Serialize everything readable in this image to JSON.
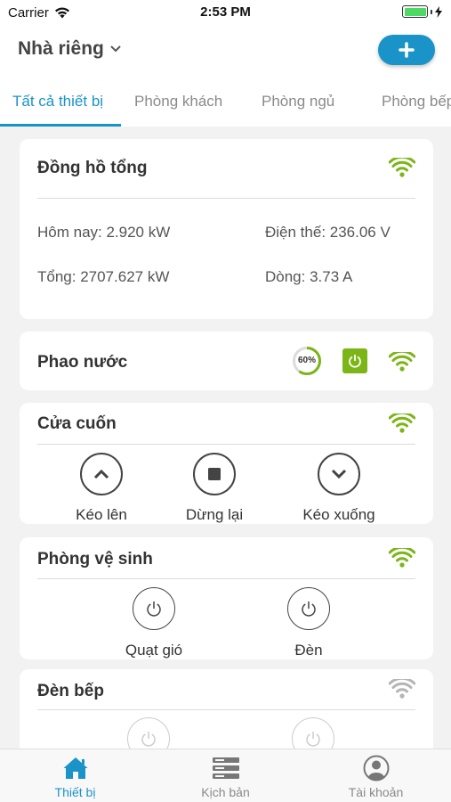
{
  "status_bar": {
    "carrier": "Carrier",
    "time": "2:53 PM"
  },
  "header": {
    "home_name": "Nhà riêng",
    "add_label": "+"
  },
  "tabs": [
    {
      "label": "Tất cả thiết bị",
      "active": true
    },
    {
      "label": "Phòng khách"
    },
    {
      "label": "Phòng ngủ"
    },
    {
      "label": "Phòng bếp"
    }
  ],
  "meter": {
    "title": "Đồng hồ tổng",
    "today": "Hôm nay: 2.920 kW",
    "voltage": "Điện thế: 236.06 V",
    "total": "Tổng: 2707.627 kW",
    "current": "Dòng: 3.73 A"
  },
  "float": {
    "title": "Phao nước",
    "level_text": "60%",
    "level": 0.6
  },
  "shutter": {
    "title": "Cửa cuốn",
    "up": "Kéo lên",
    "stop": "Dừng lại",
    "down": "Kéo xuống"
  },
  "bathroom": {
    "title": "Phòng vệ sinh",
    "fan": "Quạt gió",
    "light": "Đèn"
  },
  "kitchen_light": {
    "title": "Đèn bếp"
  },
  "bottom_nav": [
    {
      "label": "Thiết bị",
      "icon": "home-icon",
      "active": true
    },
    {
      "label": "Kịch bản",
      "icon": "scenario-icon"
    },
    {
      "label": "Tài khoản",
      "icon": "account-icon"
    }
  ],
  "colors": {
    "accent": "#1a93c9",
    "online": "#7cb518",
    "offline": "#b5b5b5"
  }
}
